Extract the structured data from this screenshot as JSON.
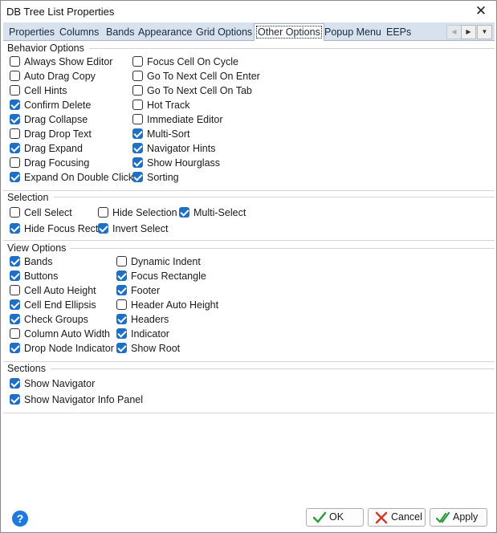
{
  "window": {
    "title": "DB Tree List Properties",
    "close_glyph": "✕"
  },
  "tabs": [
    "Properties",
    "Columns",
    "Bands",
    "Appearance",
    "Grid Options",
    "Other Options",
    "Popup Menu",
    "EEPs"
  ],
  "active_tab": "Other Options",
  "tab_nav": {
    "prev": "◀",
    "next": "▶",
    "menu": "▼"
  },
  "behavior": {
    "title": "Behavior Options",
    "col1": [
      {
        "label": "Always Show Editor",
        "checked": false
      },
      {
        "label": "Auto Drag Copy",
        "checked": false
      },
      {
        "label": "Cell Hints",
        "checked": false
      },
      {
        "label": "Confirm Delete",
        "checked": true
      },
      {
        "label": "Drag Collapse",
        "checked": true
      },
      {
        "label": "Drag Drop Text",
        "checked": false
      },
      {
        "label": "Drag Expand",
        "checked": true
      },
      {
        "label": "Drag Focusing",
        "checked": false
      },
      {
        "label": "Expand On Double Click",
        "checked": true
      }
    ],
    "col2": [
      {
        "label": "Focus Cell On Cycle",
        "checked": false
      },
      {
        "label": "Go To Next Cell On Enter",
        "checked": false
      },
      {
        "label": "Go To Next Cell On Tab",
        "checked": false
      },
      {
        "label": "Hot Track",
        "checked": false
      },
      {
        "label": "Immediate Editor",
        "checked": false
      },
      {
        "label": "Multi-Sort",
        "checked": true
      },
      {
        "label": "Navigator Hints",
        "checked": true
      },
      {
        "label": "Show Hourglass",
        "checked": true
      },
      {
        "label": "Sorting",
        "checked": true
      }
    ]
  },
  "selection": {
    "title": "Selection",
    "row1": [
      {
        "label": "Cell Select",
        "checked": false
      },
      {
        "label": "Hide Selection",
        "checked": false
      },
      {
        "label": "Multi-Select",
        "checked": true
      }
    ],
    "row2": [
      {
        "label": "Hide Focus Rect",
        "checked": true
      },
      {
        "label": "Invert Select",
        "checked": true
      }
    ]
  },
  "view": {
    "title": "View Options",
    "col1": [
      {
        "label": "Bands",
        "checked": true
      },
      {
        "label": "Buttons",
        "checked": true
      },
      {
        "label": "Cell Auto Height",
        "checked": false
      },
      {
        "label": "Cell End Ellipsis",
        "checked": true
      },
      {
        "label": "Check Groups",
        "checked": true
      },
      {
        "label": "Column Auto Width",
        "checked": false
      },
      {
        "label": "Drop Node Indicator",
        "checked": true
      }
    ],
    "col2": [
      {
        "label": "Dynamic Indent",
        "checked": false
      },
      {
        "label": "Focus Rectangle",
        "checked": true
      },
      {
        "label": "Footer",
        "checked": true
      },
      {
        "label": "Header Auto Height",
        "checked": false
      },
      {
        "label": "Headers",
        "checked": true
      },
      {
        "label": "Indicator",
        "checked": true
      },
      {
        "label": "Show Root",
        "checked": true
      }
    ]
  },
  "sections": {
    "title": "Sections",
    "items": [
      {
        "label": "Show Navigator",
        "checked": true
      },
      {
        "label": "Show Navigator Info Panel",
        "checked": true
      }
    ]
  },
  "footer": {
    "help": "?",
    "ok": "OK",
    "cancel": "Cancel",
    "apply": "Apply"
  },
  "colors": {
    "accent": "#1f6fc5",
    "tab_strip": "#d8e2ee",
    "ok_check": "#2e9d3a",
    "cancel_x": "#d23a2a"
  }
}
